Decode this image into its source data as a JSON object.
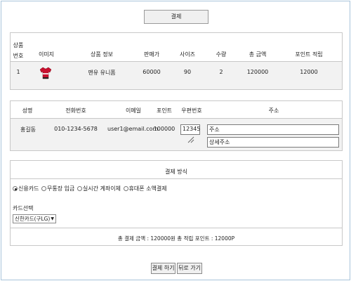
{
  "header": {
    "title": "결제"
  },
  "products": {
    "columns": [
      "상품\n번호",
      "이미지",
      "상품 정보",
      "판매가",
      "사이즈",
      "수량",
      "총 금액",
      "포인트 적립"
    ],
    "col_number_line1": "상품",
    "col_number_line2": "번호",
    "col_image": "이미지",
    "col_info": "상품 정보",
    "col_price": "판매가",
    "col_size": "사이즈",
    "col_qty": "수량",
    "col_total": "총 금액",
    "col_points": "포인트 적립",
    "rows": [
      {
        "number": "1",
        "image_icon": "red-jersey-icon",
        "info": "맨유 유니폼",
        "price": "60000",
        "size": "90",
        "qty": "2",
        "total": "120000",
        "points": "12000"
      }
    ]
  },
  "customer": {
    "col_name": "성명",
    "col_phone": "전화번호",
    "col_email": "이메일",
    "col_points": "포인트",
    "col_zip": "우편번호",
    "col_address": "주소",
    "name": "홍길동",
    "phone": "010-1234-5678",
    "email": "user1@email.com",
    "points": "100000",
    "zip_value": "12345",
    "address_value": "주소",
    "address_detail_value": "상세주소"
  },
  "payment": {
    "title": "결제 방식",
    "methods": [
      {
        "label": "신용카드",
        "selected": true
      },
      {
        "label": "무통장 입금",
        "selected": false
      },
      {
        "label": "실시간 계좌이체",
        "selected": false
      },
      {
        "label": "휴대폰 소액결제",
        "selected": false
      }
    ],
    "card_label": "카드선택",
    "card_selected": "신한카드(구LG)",
    "summary": "총 결제 금액 : 120000원   총 적립 포인트 : 12000P"
  },
  "actions": {
    "pay_label": "결제 하기",
    "back_label": "뒤로 가기"
  },
  "colors": {
    "frame_border": "#a9c4dc",
    "row_bg": "#f2f2f2",
    "jersey_red": "#c8102e"
  }
}
